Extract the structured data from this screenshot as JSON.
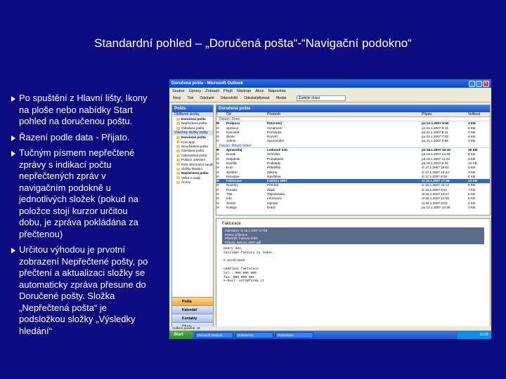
{
  "slide": {
    "title": "Standardní pohled – „Doručená pošta“-“Navigační podokno“",
    "bullets": [
      "Po spuštění z Hlavní lišty, Ikony na ploše nebo nabídky Start pohled na doručenou poštu.",
      "Řazení podle data - Přijato.",
      "Tučným písmem nepřečtené zprávy s indikací počtu nepřečtených zpráv v navigačním podokně u jednotlivých složek (pokud na položce stojí kurzor určitou dobu, je zpráva pokládána za přečtenou)",
      "Určitou výhodou je prvotní zobrazení Nepřečtené pošty, po přečtení a aktualizaci složky se automaticky zpráva přesune do Doručené pošty. Složka „Nepřečtená pošta“ je podsložkou složky „Výsledky hledání“"
    ]
  },
  "outlook": {
    "title": "Doručená pošta - Microsoft Outlook",
    "menu": [
      "Soubor",
      "Úpravy",
      "Zobrazit",
      "Přejít",
      "Nástroje",
      "Akce",
      "Nápověda"
    ],
    "toolbar": [
      "Nový",
      "Tisk",
      "Odstranit",
      "Odpovědět",
      "Odeslat/přijmout",
      "Hledat"
    ],
    "search_placeholder": "Zadejte dotaz",
    "nav": {
      "title": "Pošta",
      "favorites_header": "Oblíbené složky",
      "favorites": [
        "Doručená pošta",
        "Nepřečtená pošta",
        "Odeslaná pošta"
      ],
      "all_header": "Všechny složky pošty",
      "folders": [
        {
          "label": "Doručená pošta",
          "bold": true
        },
        {
          "label": "Koncepty",
          "bold": false
        },
        {
          "label": "Nevyžádaná pošta",
          "bold": false
        },
        {
          "label": "Odeslaná pošta",
          "bold": false
        },
        {
          "label": "Odstraněná pošta",
          "bold": false
        },
        {
          "label": "Pošta k odeslání",
          "bold": false
        },
        {
          "label": "RSS informační kanály",
          "bold": false
        },
        {
          "label": "Složky hledání",
          "bold": false
        },
        {
          "label": "Nepřečtená pošta",
          "bold": true
        },
        {
          "label": "Velké e-maily",
          "bold": false
        },
        {
          "label": "Archiv",
          "bold": false
        }
      ],
      "buttons": [
        "Pošta",
        "Kalendář",
        "Kontakty",
        "Úkoly"
      ]
    },
    "list": {
      "title": "Doručená pošta",
      "columns": [
        "!",
        "Od",
        "Předmět",
        "Přijato",
        "Velikost"
      ],
      "groups": [
        {
          "label": "Datum: Dnes",
          "rows": [
            {
              "from": "Podpora",
              "subject": "Potvrzení",
              "date": "po 21.1.2007 9:50",
              "size": "3 KB",
              "bold": true
            },
            {
              "from": "Správce",
              "subject": "Oznámení",
              "date": "po 21.1.2007 9:44",
              "size": "5 KB",
              "bold": false
            },
            {
              "from": "Kancelář",
              "subject": "Pozvánka",
              "date": "po 21.1.2007 8:11",
              "size": "4 KB",
              "bold": false
            },
            {
              "from": "Škola",
              "subject": "Rozvrh",
              "date": "po 21.1.2007 7:03",
              "size": "6 KB",
              "bold": false
            },
            {
              "from": "Admin",
              "subject": "Upozornění",
              "date": "po 21.1.2007 6:55",
              "size": "3 KB",
              "bold": false
            }
          ]
        },
        {
          "label": "Datum: Minulý týden",
          "rows": [
            {
              "from": "Zpravodaj",
              "subject": "Lednové info",
              "date": "pá 18.1.2007 16:10",
              "size": "18 KB",
              "bold": true
            },
            {
              "from": "Novák",
              "subject": "Schůzka",
              "date": "pá 18.1.2007 13:29",
              "size": "8 KB",
              "bold": false
            },
            {
              "from": "Helpdesk",
              "subject": "Požadavek",
              "date": "pá 18.1.2007 11:04",
              "size": "4 KB",
              "bold": false
            },
            {
              "from": "Dvořák",
              "subject": "Podklady",
              "date": "pá 18.1.2007 9:32",
              "size": "12 KB",
              "bold": false
            },
            {
              "from": "Kurz",
              "subject": "Přihláška",
              "date": "čt 17.1.2007 15:02",
              "size": "5 KB",
              "bold": false
            },
            {
              "from": "Systém",
              "subject": "Záloha",
              "date": "čt 17.1.2007 10:44",
              "size": "3 KB",
              "bold": false
            },
            {
              "from": "Recepce",
              "subject": "Návštěva",
              "date": "čt 17.1.2007 8:20",
              "size": "4 KB",
              "bold": false
            },
            {
              "from": "Fakturace",
              "subject": "Faktura 2007",
              "date": "st 16.1.2007 17:58",
              "size": "24 KB",
              "bold": true,
              "selected": true
            },
            {
              "from": "Novinky",
              "subject": "Přehled",
              "date": "st 16.1.2007 12:14",
              "size": "9 KB",
              "bold": false
            },
            {
              "from": "Porada",
              "subject": "Zápis",
              "date": "st 16.1.2007 9:41",
              "size": "7 KB",
              "bold": false
            },
            {
              "from": "Tisk",
              "subject": "Objednávka",
              "date": "út 15.1.2007 14:27",
              "size": "6 KB",
              "bold": false
            },
            {
              "from": "Info",
              "subject": "Informace",
              "date": "út 15.1.2007 10:30",
              "size": "5 KB",
              "bold": false
            },
            {
              "from": "Servis",
              "subject": "Oprava",
              "date": "út 15.1.2007 8:03",
              "size": "4 KB",
              "bold": false
            },
            {
              "from": "Kolega",
              "subject": "Dotaz",
              "date": "po 14.1.2007 16:48",
              "size": "3 KB",
              "bold": false
            }
          ]
        }
      ]
    },
    "preview": {
      "from": "Fakturace",
      "header_lines": [
        "Odesláno: st 16.1.2007 17:58",
        "Komu: příjemce",
        "Předmět: Faktura 2007",
        "Přílohy: faktura_2007.pdf"
      ],
      "body_lines": [
        "Dobrý den,",
        "zasíláme fakturu za leden.",
        "",
        "S pozdravem",
        "",
        "oddělení fakturace",
        "tel.: 000 000 000",
        "fax: 000 000 001",
        "e-mail: info@firma.cz"
      ]
    },
    "statusbar": "Celkem položek: 19",
    "taskbar": {
      "start": "Start",
      "items": [
        "Microsoft Outlook",
        "Dokument1",
        "Prezentace"
      ],
      "clock": "10:05"
    }
  }
}
